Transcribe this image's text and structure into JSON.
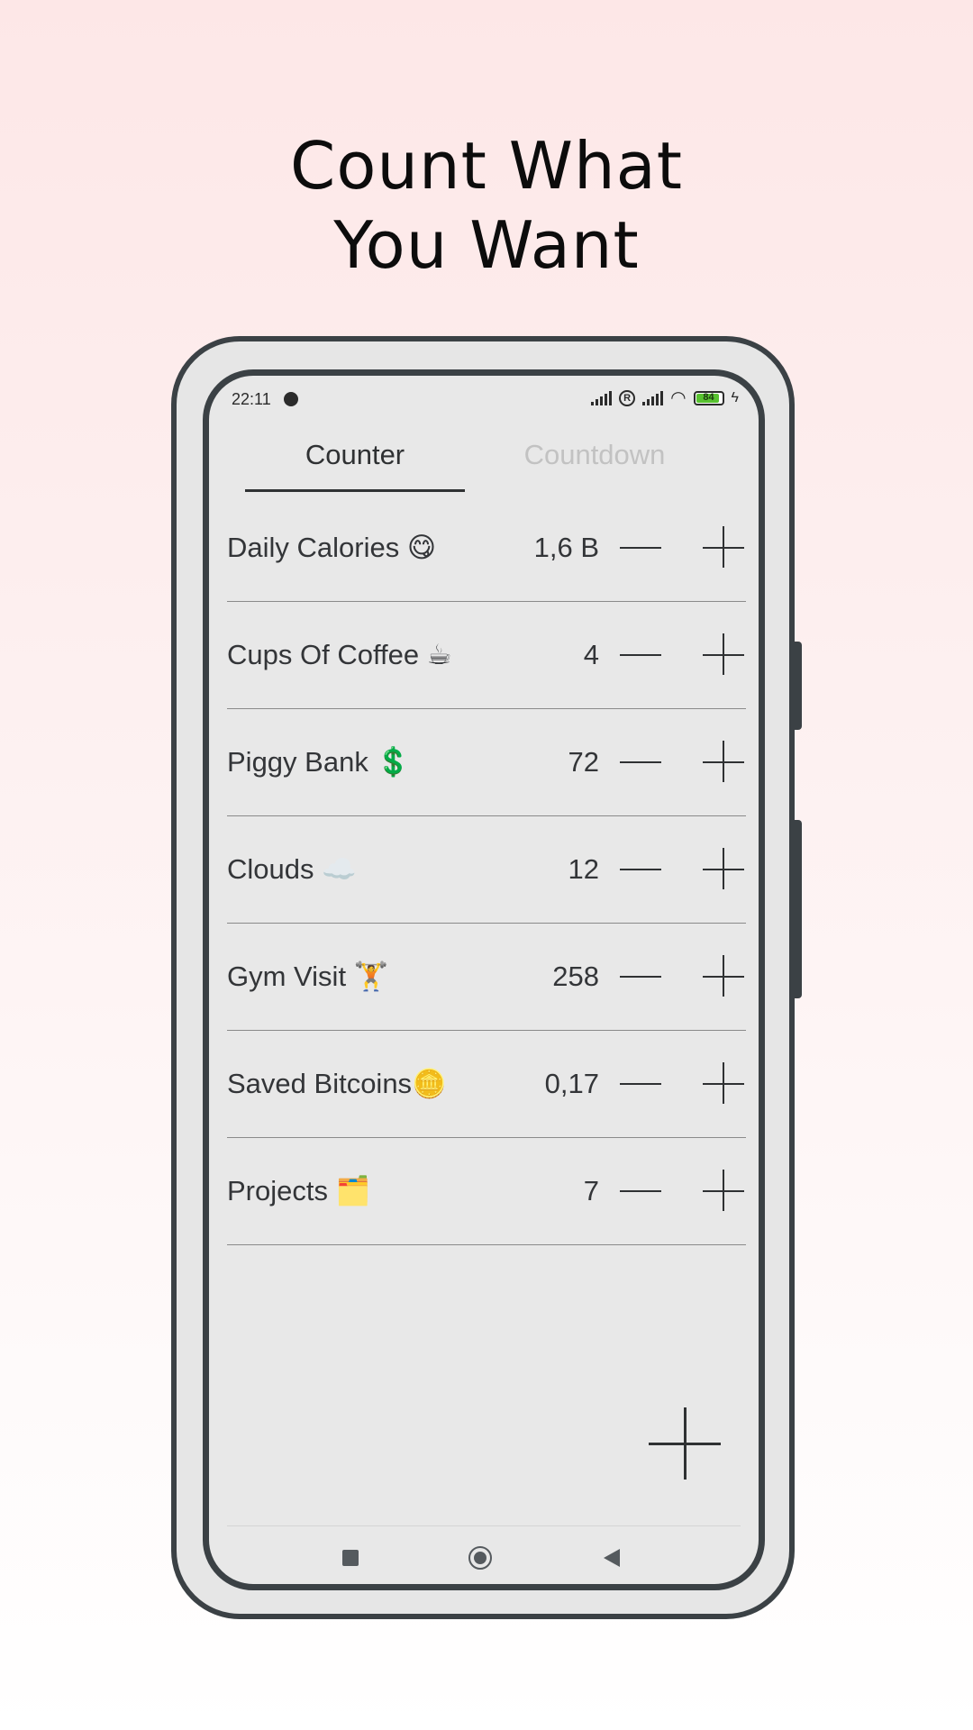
{
  "headline": {
    "line1": "Count What",
    "line2": "You Want"
  },
  "status_bar": {
    "time": "22:11",
    "battery_level": "84",
    "battery_fraction": 0.84
  },
  "tabs": [
    {
      "label": "Counter",
      "active": true
    },
    {
      "label": "Countdown",
      "active": false
    }
  ],
  "counters": [
    {
      "name": "Daily Calories 😋",
      "value": "1,6 B"
    },
    {
      "name": "Cups Of Coffee ☕",
      "value": "4"
    },
    {
      "name": "Piggy Bank 💲",
      "value": "72"
    },
    {
      "name": "Clouds ☁️",
      "value": "12"
    },
    {
      "name": "Gym Visit 🏋️",
      "value": "258"
    },
    {
      "name": "Saved Bitcoins🪙",
      "value": "0,17"
    },
    {
      "name": "Projects 🗂️",
      "value": "7"
    }
  ],
  "icons": {
    "decrement": "minus-icon",
    "increment": "plus-icon",
    "add": "plus-icon",
    "recents": "square-icon",
    "home": "circle-icon",
    "back": "triangle-icon"
  },
  "colors": {
    "background_top": "#fde7e7",
    "screen": "#e8e8e8",
    "frame": "#3b4145",
    "text": "#2f3133",
    "inactive_tab": "#c2c2c2",
    "battery": "#58c230"
  }
}
